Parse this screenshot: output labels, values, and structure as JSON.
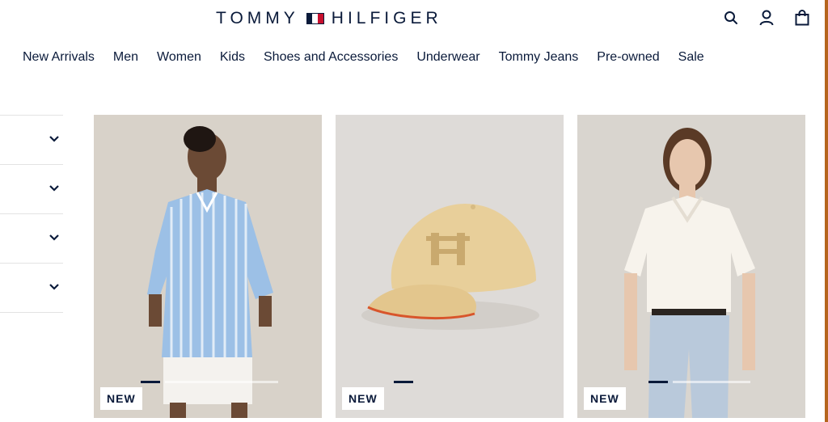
{
  "brand": {
    "part1": "TOMMY",
    "part2": "HILFIGER"
  },
  "header_icons": [
    {
      "name": "search-icon"
    },
    {
      "name": "account-icon"
    },
    {
      "name": "bag-icon"
    }
  ],
  "nav": {
    "items": [
      {
        "label": "New Arrivals"
      },
      {
        "label": "Men"
      },
      {
        "label": "Women"
      },
      {
        "label": "Kids"
      },
      {
        "label": "Shoes and Accessories"
      },
      {
        "label": "Underwear"
      },
      {
        "label": "Tommy Jeans"
      },
      {
        "label": "Pre-owned"
      },
      {
        "label": "Sale"
      }
    ]
  },
  "filters": {
    "count": 4,
    "icon": "chevron-down-icon"
  },
  "products": [
    {
      "badge": "NEW",
      "image": "woman in blue striped shirt and white shorts",
      "background": "#d8d2c9"
    },
    {
      "badge": "NEW",
      "image": "beige baseball cap",
      "background": "#dedbd8"
    },
    {
      "badge": "NEW",
      "image": "woman in white polo shirt and light jeans",
      "background": "#d9d5cf"
    }
  ],
  "colors": {
    "navy": "#0a1a3a",
    "flag_red": "#c8102e",
    "accent_strip": "#b5651d"
  }
}
